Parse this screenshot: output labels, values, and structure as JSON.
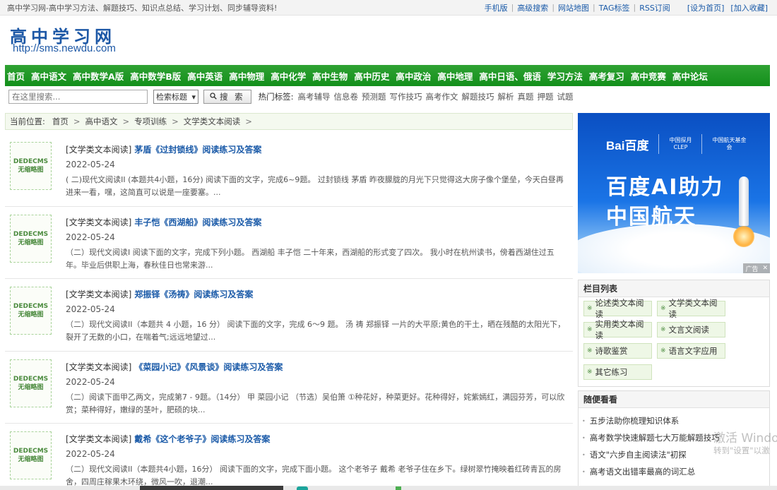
{
  "topbar": {
    "tagline": "高中学习网-高中学习方法、解题技巧、知识点总结、学习计划、同步辅导资料!",
    "links": [
      "手机版",
      "高级搜索",
      "网站地图",
      "TAG标签",
      "RSS订阅"
    ],
    "set_home": "[设为首页]",
    "add_fav": "[加入收藏]"
  },
  "header": {
    "logo_title": "高中学习网",
    "logo_url": "http://sms.newdu.com"
  },
  "nav": [
    "首页",
    "高中语文",
    "高中数学A版",
    "高中数学B版",
    "高中英语",
    "高中物理",
    "高中化学",
    "高中生物",
    "高中历史",
    "高中政治",
    "高中地理",
    "高中日语、俄语",
    "学习方法",
    "高考复习",
    "高中竞赛",
    "高中论坛"
  ],
  "search": {
    "placeholder": "在这里搜索...",
    "select_value": "检索标题",
    "button": "搜 索",
    "hot_label": "热门标签:",
    "hot_tags": [
      "高考辅导",
      "信息卷",
      "预测题",
      "写作技巧",
      "高考作文",
      "解题技巧",
      "解析",
      "真题",
      "押题",
      "试题"
    ]
  },
  "breadcrumb": {
    "label": "当前位置:",
    "items": [
      "首页",
      "高中语文",
      "专项训练",
      "文学类文本阅读"
    ]
  },
  "thumb": {
    "line1": "DEDECMS",
    "line2": "无缩略图"
  },
  "articles": [
    {
      "category": "[文学类文本阅读]",
      "title": "茅盾《过封锁线》阅读练习及答案",
      "date": "2022-05-24",
      "desc": "( 二)现代文阅读II (本题共4小题，16分) 阅读下面的文字，完成6~9题。 过封锁线 茅盾 昨夜朦胧的月光下只觉得这大房子像个堡垒，今天白昼再进来一看，嘿，这简直可以说是一座要塞。..."
    },
    {
      "category": "[文学类文本阅读]",
      "title": "丰子恺《西湖船》阅读练习及答案",
      "date": "2022-05-24",
      "desc": "（二）现代文阅读I 阅读下面的文字，完成下列小题。 西湖船 丰子恺 二十年来，西湖船的形式变了四次。 我小时在杭州读书，傍着西湖住过五年。毕业后供职上海，春秋佳日也常来游..."
    },
    {
      "category": "[文学类文本阅读]",
      "title": "郑振铎《汤祷》阅读练习及答案",
      "date": "2022-05-24",
      "desc": "（二）现代文阅读II（本题共 4 小题，16 分） 阅读下面的文字，完成 6～9 题。 汤 祷 郑振铎 一片的大平原;黄色的干土，晒在残酷的太阳光下，裂开了无数的小口，在喘着气;远远地望过..."
    },
    {
      "category": "[文学类文本阅读]",
      "title": "《菜园小记》《风景谈》阅读练习及答案",
      "date": "2022-05-24",
      "desc": "（二）阅读下面甲乙两文，完成第7 - 9题。（14分） 甲 菜园小记 （节选）吴伯箫 ①种花好，种菜更好。花种得好，姹紫嫣红，满园芬芳，可以欣赏；菜种得好，嫩绿的茎叶，肥硕的块..."
    },
    {
      "category": "[文学类文本阅读]",
      "title": "戴希《这个老爷子》阅读练习及答案",
      "date": "2022-05-24",
      "desc": "（二）现代文阅读II（本题共4小题，16分） 阅读下面的文字，完成下面小题。 这个老爷子 戴希 老爷子住在乡下。绿树翠竹掩映着红砖青瓦的房舍，四周庄稼果木环绕，微风一吹，退潮..."
    }
  ],
  "ad": {
    "brand": "Bai百度",
    "partner1": "中国探月",
    "partner1_sub": "CLEP",
    "partner2": "中国航天基金会",
    "line1": "百度AI助力",
    "line2": "中国航天",
    "badge": "广告"
  },
  "columns": {
    "title": "栏目列表",
    "items": [
      "论述类文本阅读",
      "文学类文本阅读",
      "实用类文本阅读",
      "文言文阅读",
      "诗歌鉴赏",
      "语言文字应用",
      "其它练习"
    ]
  },
  "random": {
    "title": "随便看看",
    "items": [
      "五步法助你梳理知识体系",
      "高考数学快速解题七大万能解题技巧",
      "语文\"六步自主阅读法\"初探",
      "高考语文出错率最高的词汇总"
    ]
  },
  "watermark": {
    "line1": "激活 Windo",
    "line2": "转到\"设置\"以激"
  }
}
